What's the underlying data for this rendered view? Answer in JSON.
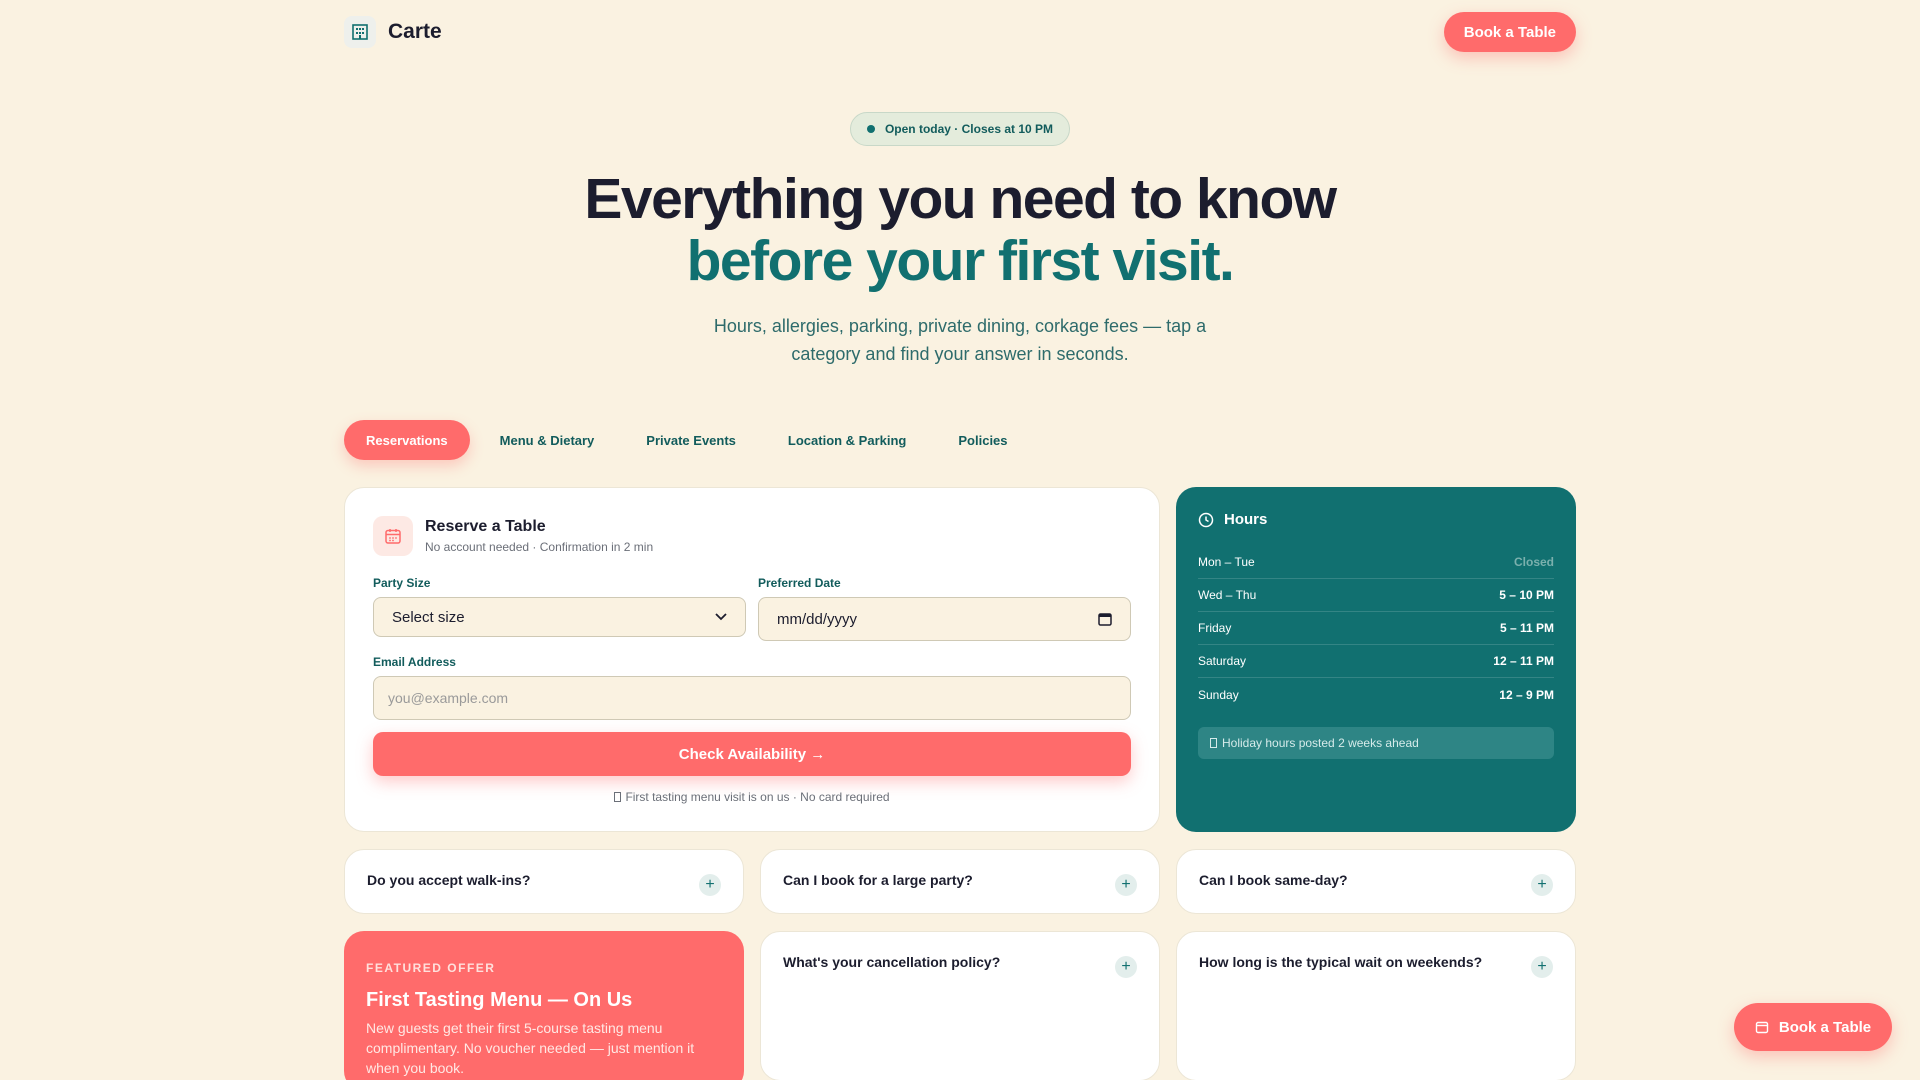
{
  "header": {
    "brand": "Carte",
    "cta_label": "Book a Table"
  },
  "hero": {
    "status": "Open today · Closes at 10 PM",
    "title_line1": "Everything you need to know",
    "title_line2": "before your first visit.",
    "subtitle": "Hours, allergies, parking, private dining, corkage fees — tap a category and find your answer in seconds."
  },
  "tabs": [
    {
      "label": "Reservations",
      "active": true
    },
    {
      "label": "Menu & Dietary",
      "active": false
    },
    {
      "label": "Private Events",
      "active": false
    },
    {
      "label": "Location & Parking",
      "active": false
    },
    {
      "label": "Policies",
      "active": false
    }
  ],
  "reserve": {
    "title": "Reserve a Table",
    "subtitle": "No account needed · Confirmation in 2 min",
    "party_label": "Party Size",
    "party_value": "Select size",
    "date_label": "Preferred Date",
    "date_placeholder": "mm/dd/yyyy",
    "email_label": "Email Address",
    "email_placeholder": "you@example.com",
    "button": "Check Availability →",
    "fine_print": "First tasting menu visit is on us · No card required"
  },
  "hours": {
    "title": "Hours",
    "rows": [
      {
        "day": "Mon – Tue",
        "time": "Closed"
      },
      {
        "day": "Wed – Thu",
        "time": "5 – 10 PM"
      },
      {
        "day": "Friday",
        "time": "5 – 11 PM"
      },
      {
        "day": "Saturday",
        "time": "12 – 11 PM"
      },
      {
        "day": "Sunday",
        "time": "12 – 9 PM"
      }
    ],
    "note": "Holiday hours posted 2 weeks ahead"
  },
  "faq": [
    "Do you accept walk-ins?",
    "Can I book for a large party?",
    "Can I book same-day?",
    "What's your cancellation policy?",
    "How long is the typical wait on weekends?"
  ],
  "offer": {
    "tag": "FEATURED OFFER",
    "title": "First Tasting Menu — On Us",
    "text": "New guests get their first 5-course tasting menu complimentary. No voucher needed — just mention it when you book."
  },
  "floating_cta": "Book a Table",
  "colors": {
    "coral": "#ff6b6b",
    "teal": "#117070",
    "cream": "#faf2e1"
  }
}
